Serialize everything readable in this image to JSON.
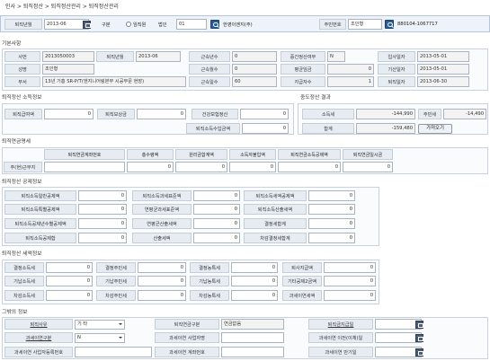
{
  "breadcrumb": "인사 > 퇴직정산 > 퇴직정산관리 > 퇴직정산관리",
  "search": {
    "year_label": "퇴직년월",
    "year_value": "2013-06",
    "kind_label": "구분",
    "kind_option": "임직원",
    "corp_label": "법인",
    "corp_code": "01",
    "corp_name": "한영이엔지(주)",
    "resno_label": "주민번호",
    "resno_name": "조인형",
    "resno_value": "880104-1067717"
  },
  "basic": {
    "title": "기본사항",
    "r1": {
      "a_l": "사번",
      "a_v": "2013050003",
      "b_l": "퇴직년월",
      "b_v": "2013-06",
      "c_l": "근속년수",
      "c_v": "0",
      "d_l": "중간정산여부",
      "d_v": "N",
      "e_l": "입사일자",
      "e_v": "2013-05-01"
    },
    "r2": {
      "a_l": "성명",
      "a_v": "조인형",
      "c_l": "근속월수",
      "c_v": "0",
      "d_l": "평균임금",
      "d_v": "0",
      "e_l": "기산일자",
      "e_v": "2013-05-01"
    },
    "r3": {
      "a_l": "부서",
      "a_v": "13년 기흥 SR-P/T(엔지니어링본부 시공부문 현장)",
      "c_l": "근속일수",
      "c_v": "60",
      "d_l": "지급자수",
      "d_v": "1",
      "e_l": "퇴직일자",
      "e_v": "2013-06-30"
    }
  },
  "calc": {
    "title": "퇴직정산 소득정보",
    "l1": "퇴직급여액",
    "v1": "0",
    "l2": "퇴직보상금",
    "v2": "0",
    "l3": "건강보험정산",
    "v3": "0",
    "l4": "퇴직소득수입금액",
    "v4": "0"
  },
  "result": {
    "title": "중도정산 결과",
    "l1": "소득세",
    "v1": "-144,990",
    "l2": "주민세",
    "v2": "-14,490",
    "l3": "합계",
    "v3": "-159,480",
    "btn": "가져오기"
  },
  "pension": {
    "title": "퇴직연금명세",
    "headers": [
      "퇴직연금계좌번호",
      "총수령액",
      "원리금합계액",
      "소득자불입액",
      "퇴직연금소득공제액",
      "퇴직연금일시금"
    ],
    "row_label": "주(현)근무지",
    "values": [
      "",
      "0",
      "0",
      "0",
      "0",
      "0"
    ]
  },
  "deduct": {
    "title": "퇴직정산 공제정보",
    "rows": [
      {
        "a_l": "퇴직소득일반공제액",
        "a_v": "0",
        "b_l": "퇴직소득과세표준액",
        "b_v": "0",
        "c_l": "퇴직소득세액공제액",
        "c_v": "0"
      },
      {
        "a_l": "퇴직소득특별공제액",
        "a_v": "0",
        "b_l": "연평균과세표준액",
        "b_v": "0",
        "c_l": "퇴직소득산출세액",
        "c_v": "0"
      },
      {
        "a_l": "퇴직소득공제년수별공제액",
        "a_v": "0",
        "b_l": "연평균산출세액",
        "b_v": "0",
        "c_l": "결정세합계",
        "c_v": "0"
      },
      {
        "a_l": "퇴직소득공제합",
        "a_v": "0",
        "b_l": "산출세액",
        "b_v": "0",
        "c_l": "차감결정세합계",
        "c_v": "0"
      }
    ]
  },
  "tax": {
    "title": "퇴직정산 세액정보",
    "rows": [
      {
        "a_l": "결정소득세",
        "a_v": "0",
        "b_l": "결정주민세",
        "b_v": "0",
        "c_l": "결정농특세",
        "c_v": "0",
        "d_l": "퇴사지급액",
        "d_v": "0"
      },
      {
        "a_l": "기납소득세",
        "a_v": "0",
        "b_l": "기납주민세",
        "b_v": "0",
        "c_l": "기납농특세",
        "c_v": "0",
        "d_l": "기타공제2금액",
        "d_v": "0"
      },
      {
        "a_l": "차감소득세",
        "a_v": "0",
        "b_l": "차감주민세",
        "b_v": "0",
        "c_l": "차감농특세",
        "c_v": "0",
        "d_l": "과세이연세액",
        "d_v": "0"
      }
    ]
  },
  "etc": {
    "title": "그밖의 정보",
    "reason_l": "퇴직사유",
    "reason_v": "기 타",
    "pension_type_l": "퇴직연금구분",
    "pension_type_v": "연금없음",
    "pension_date_l": "퇴직금지급일",
    "defer_l": "과세이연구분",
    "defer_v": "N",
    "biz_l": "과세이연 사업자명",
    "transfer_l": "과세이연 이전(이체)일",
    "bizno_l": "과세이연 사업자등록번호",
    "account_l": "과세이연 계좌번호",
    "maturity_l": "과세이연 만기일"
  }
}
